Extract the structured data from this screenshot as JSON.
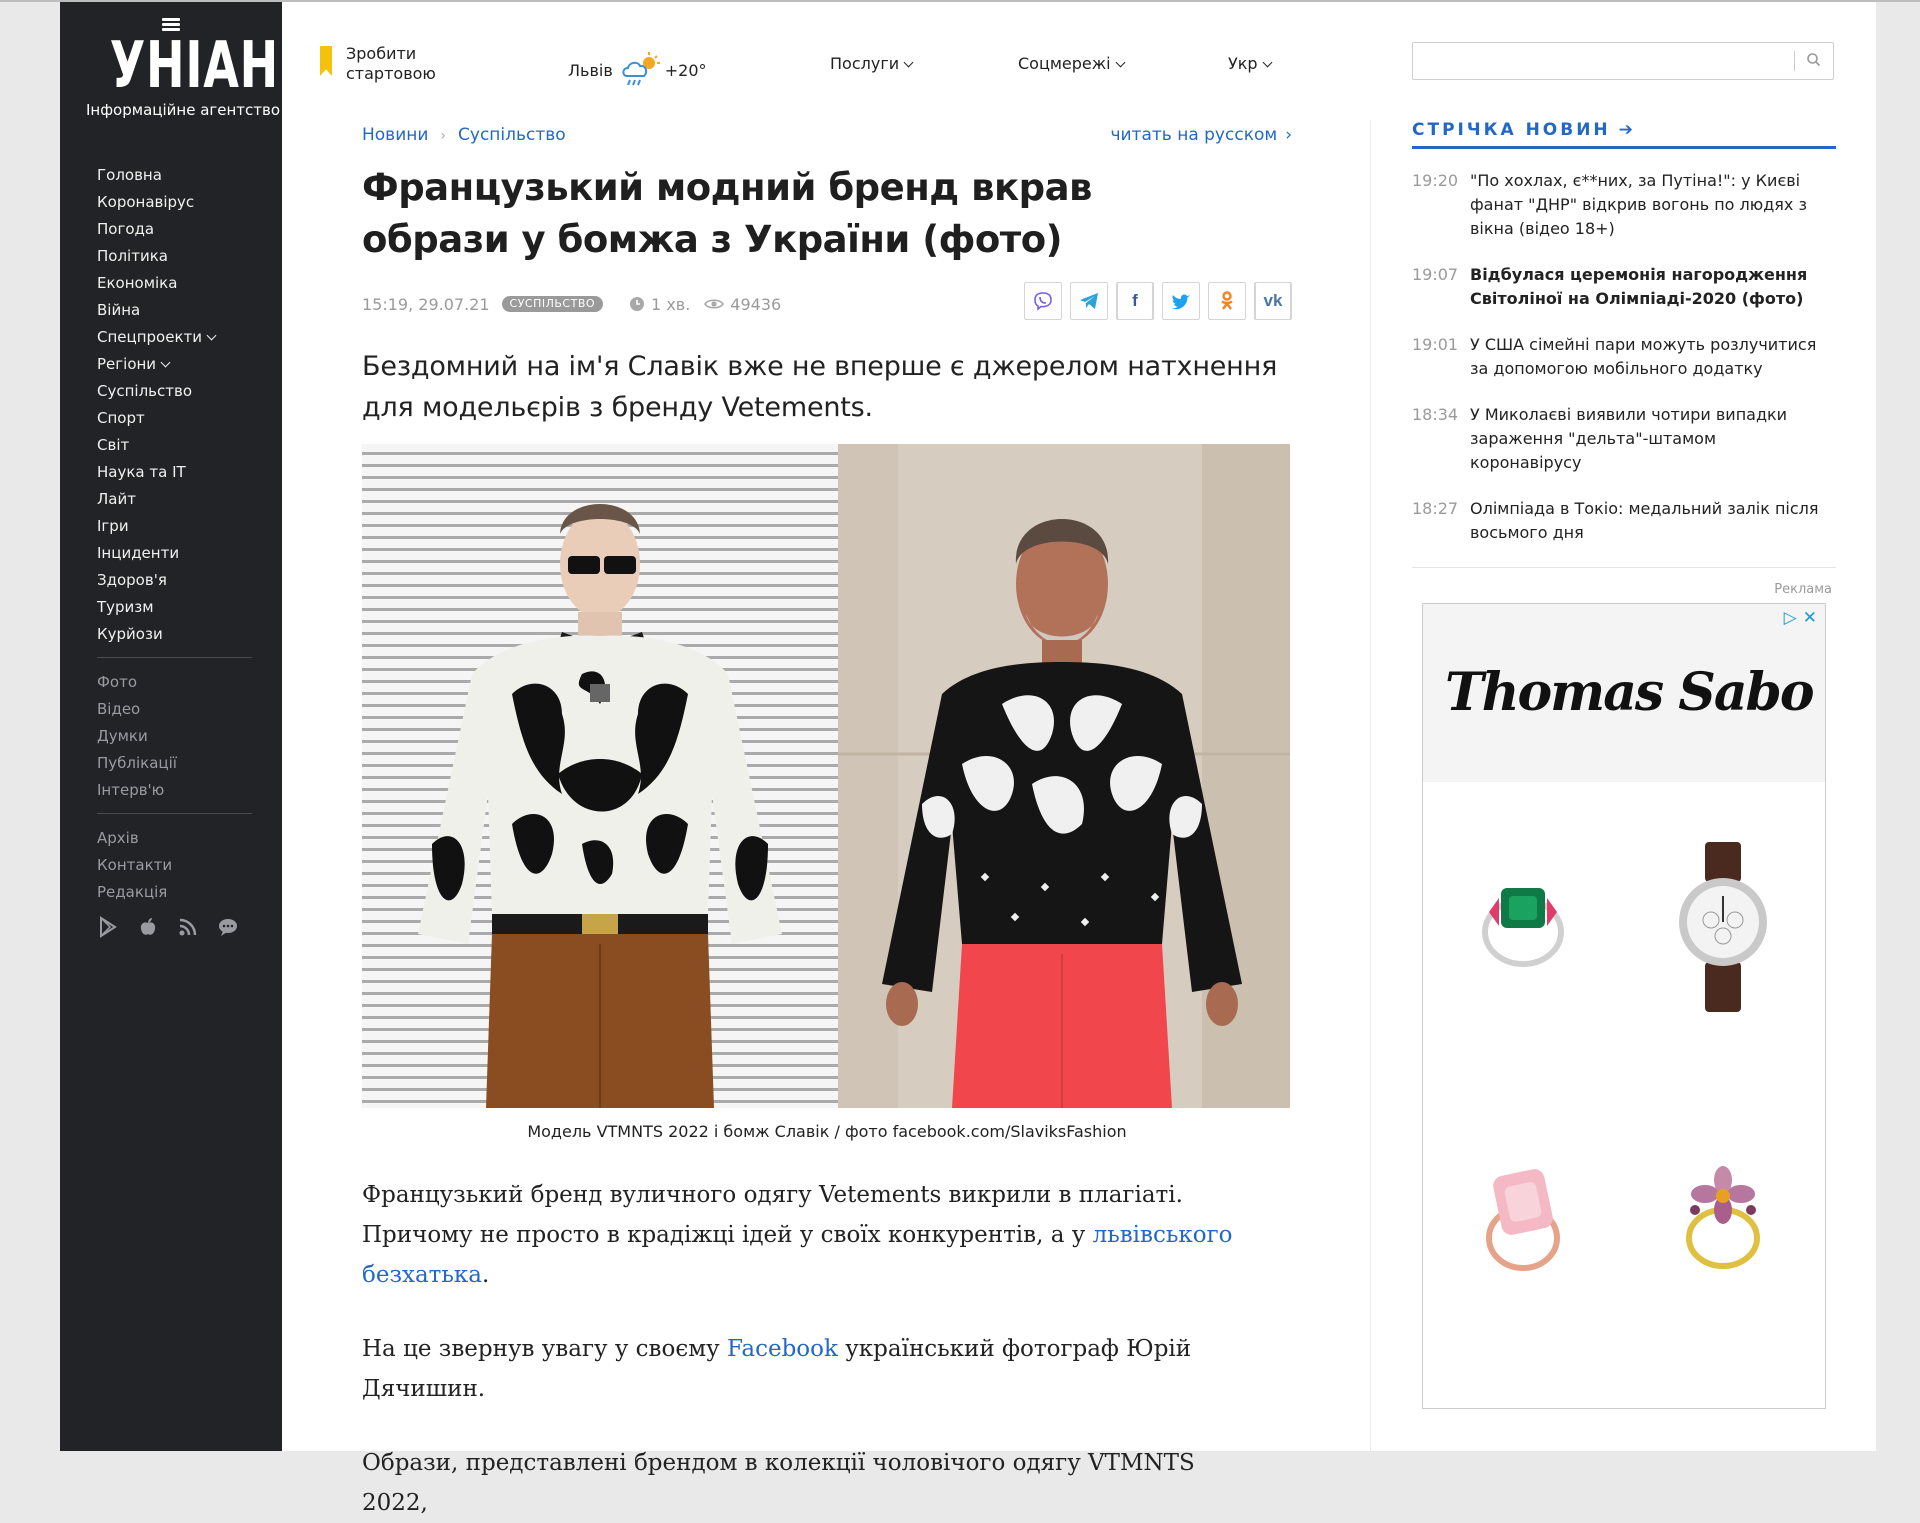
{
  "sidebar": {
    "logo_text": "УНІАН",
    "logo_subtitle": "Інформаційне агентство",
    "menu": [
      {
        "label": "Головна"
      },
      {
        "label": "Коронавірус"
      },
      {
        "label": "Погода"
      },
      {
        "label": "Політика"
      },
      {
        "label": "Економіка"
      },
      {
        "label": "Війна"
      },
      {
        "label": "Спецпроекти"
      },
      {
        "label": "Регіони"
      },
      {
        "label": "Суспільство"
      },
      {
        "label": "Спорт"
      },
      {
        "label": "Світ"
      },
      {
        "label": "Наука та IT"
      },
      {
        "label": "Лайт"
      },
      {
        "label": "Ігри"
      },
      {
        "label": "Інциденти"
      },
      {
        "label": "Здоров'я"
      },
      {
        "label": "Туризм"
      },
      {
        "label": "Курйози"
      }
    ],
    "menu2": [
      {
        "label": "Фото"
      },
      {
        "label": "Відео"
      },
      {
        "label": "Думки"
      },
      {
        "label": "Публікації"
      },
      {
        "label": "Інтерв'ю"
      }
    ],
    "menu3": [
      {
        "label": "Архів"
      },
      {
        "label": "Контакти"
      },
      {
        "label": "Редакція"
      }
    ],
    "app_icons": [
      "google-play-icon",
      "apple-icon",
      "rss-icon",
      "chat-icon"
    ]
  },
  "topbar": {
    "startpage_label": "Зробити стартовою",
    "weather_city": "Львів",
    "weather_temp": "+20°",
    "services": "Послуги",
    "social": "Соцмережі",
    "language": "Укр",
    "search_placeholder": ""
  },
  "article": {
    "breadcrumb_news": "Новини",
    "breadcrumb_section": "Суспільство",
    "read_russian": "читать на русском",
    "title": "Французький модний бренд вкрав образи у бомжа з України (фото)",
    "datetime": "15:19, 29.07.21",
    "tag": "СУСПІЛЬСТВО",
    "read_time": "1 хв.",
    "views": "49436",
    "share_icons": [
      "viber-icon",
      "telegram-icon",
      "facebook-icon",
      "twitter-icon",
      "odnoklassniki-icon",
      "vk-icon"
    ],
    "lead": "Бездомний на ім'я Славік вже не вперше є джерелом натхнення для модельєрів з бренду Vetements.",
    "caption": "Модель VTMNTS 2022 і бомж Славік / фото facebook.com/SlaviksFashion",
    "p1_a": "Французький бренд вуличного одягу Vetements викрили в плагіаті. Причому не просто в крадіжці ідей у своїх конкурентів, а у ",
    "p1_link": "львівського безхатька",
    "p1_b": ".",
    "p2_a": "На це звернув увагу у своєму ",
    "p2_link": "Facebook",
    "p2_b": " український фотограф Юрій Дячишин.",
    "p3": "Образи, представлені брендом в колекції чоловічого одягу VTMNTS 2022,"
  },
  "feed": {
    "title": "СТРІЧКА НОВИН",
    "items": [
      {
        "time": "19:20",
        "text": "\"По хохлах, є**них, за Путіна!\": у Києві фанат \"ДНР\" відкрив вогонь по людях з вікна (відео 18+)",
        "bold": false
      },
      {
        "time": "19:07",
        "text": "Відбулася церемонія нагородження Світоліної на Олімпіаді-2020 (фото)",
        "bold": true
      },
      {
        "time": "19:01",
        "text": "У США сімейні пари можуть розлучитися за допомогою мобільного додатку",
        "bold": false
      },
      {
        "time": "18:34",
        "text": "У Миколаєві виявили чотири випадки зараження \"дельта\"-штамом коронавірусу",
        "bold": false
      },
      {
        "time": "18:27",
        "text": "Олімпіада в Токіо: медальний залік після восьмого дня",
        "bold": false
      }
    ]
  },
  "ad": {
    "label": "Реклама",
    "brand": "Thomas Sabo"
  },
  "colors": {
    "sidebar_bg": "#222327",
    "accent_blue": "#2368c7",
    "bookmark_yellow": "#f4c20d"
  }
}
